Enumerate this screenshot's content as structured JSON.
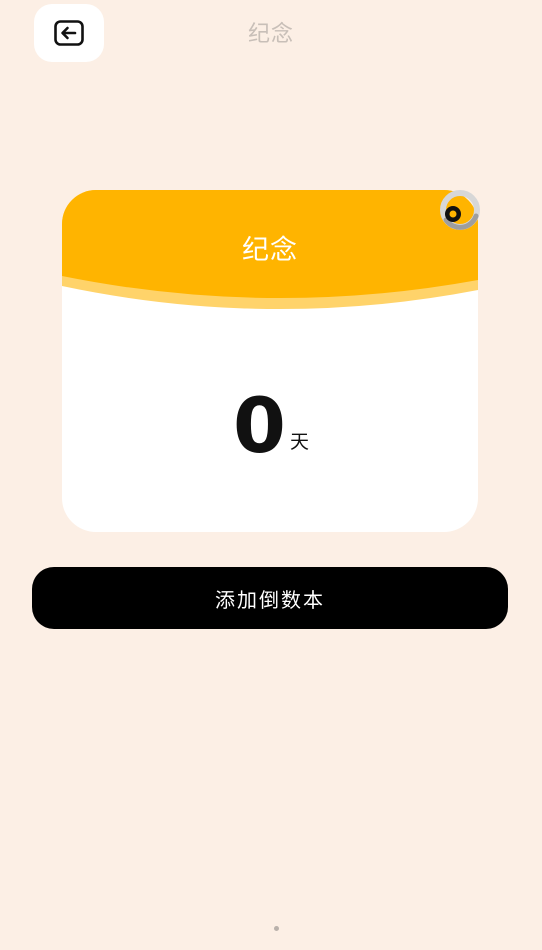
{
  "header": {
    "title": "纪念",
    "back_icon": "back-arrow-icon"
  },
  "card": {
    "title": "纪念",
    "count": "0",
    "unit": "天",
    "header_color": "#FFB400",
    "ring_icon": "binder-ring-icon"
  },
  "actions": {
    "add_label": "添加倒数本"
  },
  "colors": {
    "background": "#FCEFE5",
    "button": "#000000",
    "accent": "#FFB400"
  }
}
